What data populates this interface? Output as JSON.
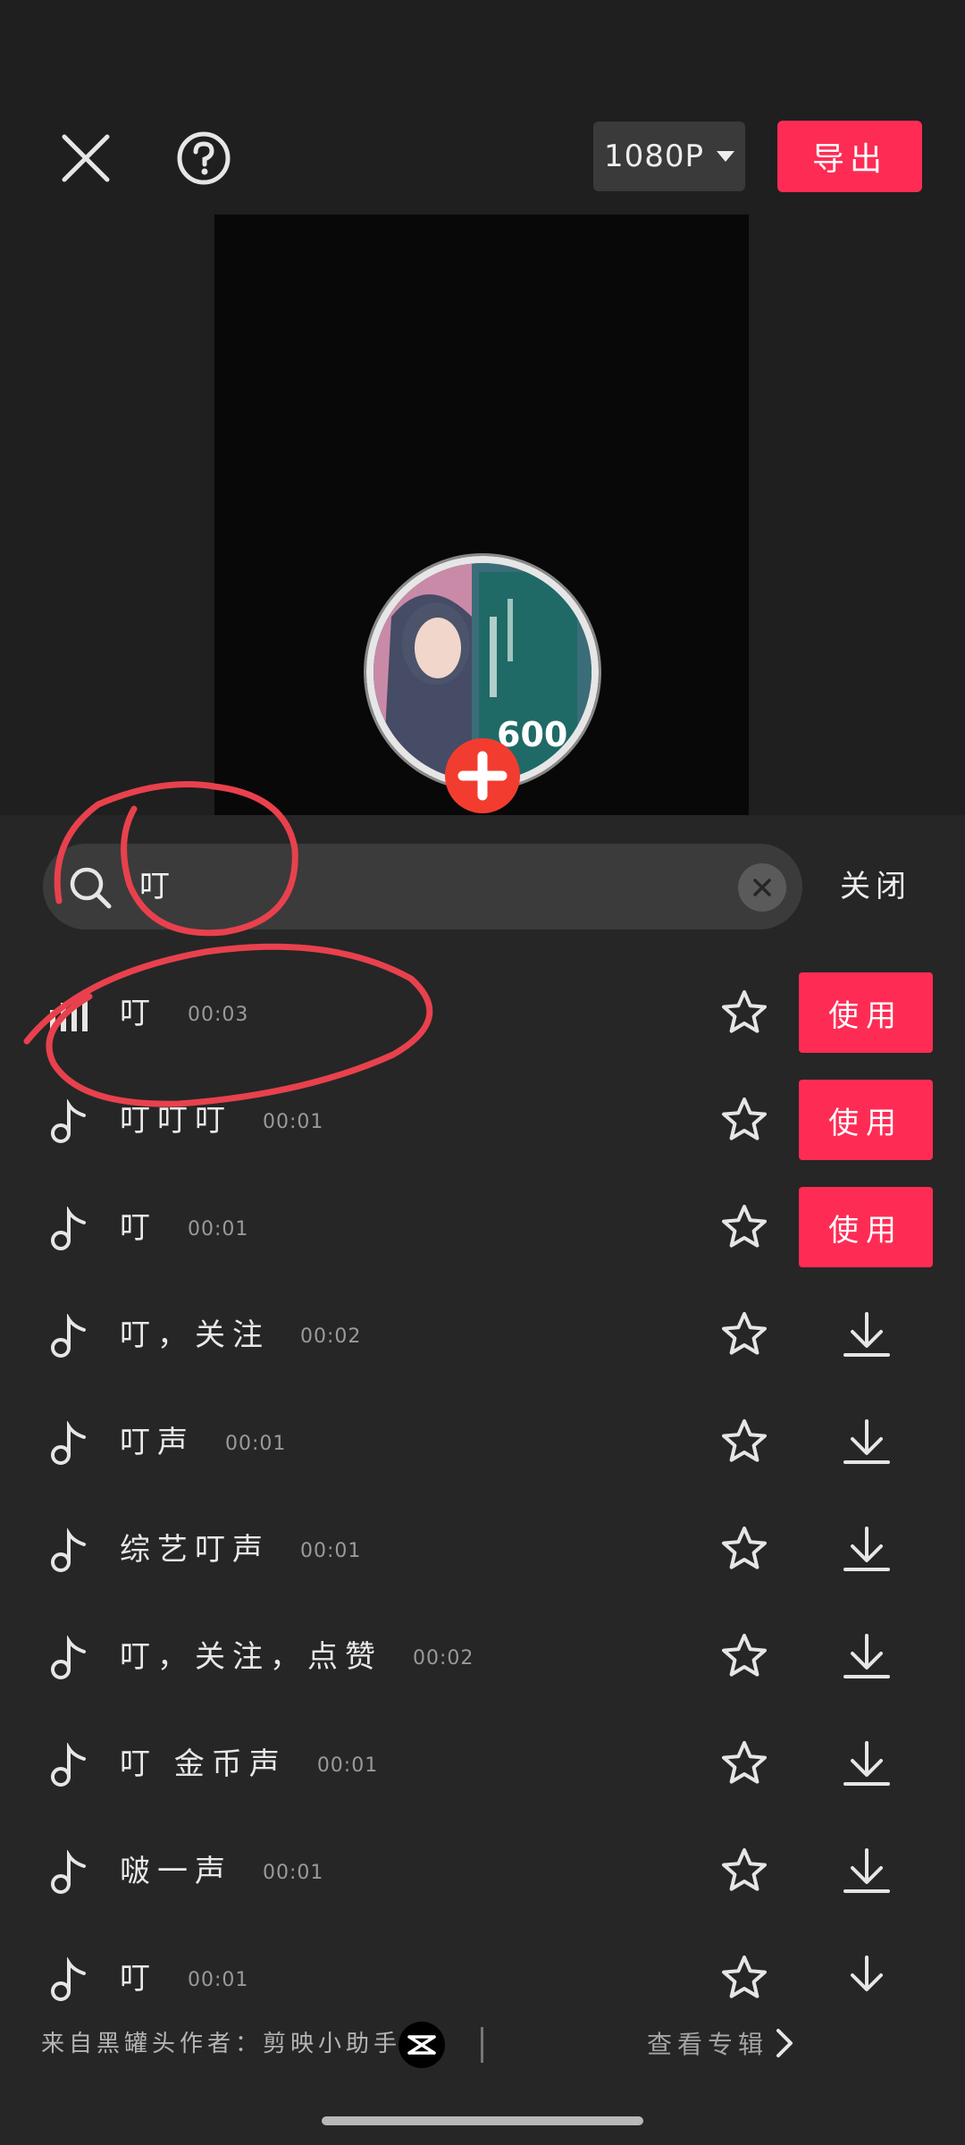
{
  "toolbar": {
    "resolution": "1080P",
    "export_label": "导出"
  },
  "search": {
    "query": "叮",
    "close_label": "关闭"
  },
  "results": [
    {
      "name": "叮",
      "duration": "00:03",
      "playing": true,
      "action": "使用"
    },
    {
      "name": "叮叮叮",
      "duration": "00:01",
      "playing": false,
      "action": "使用"
    },
    {
      "name": "叮",
      "duration": "00:01",
      "playing": false,
      "action": "使用"
    },
    {
      "name": "叮，关注",
      "duration": "00:02",
      "playing": false,
      "action": "download"
    },
    {
      "name": "叮声",
      "duration": "00:01",
      "playing": false,
      "action": "download"
    },
    {
      "name": "综艺叮声",
      "duration": "00:01",
      "playing": false,
      "action": "download"
    },
    {
      "name": "叮，关注，点赞",
      "duration": "00:02",
      "playing": false,
      "action": "download"
    },
    {
      "name": "叮 金币声",
      "duration": "00:01",
      "playing": false,
      "action": "download"
    },
    {
      "name": "啵一声",
      "duration": "00:01",
      "playing": false,
      "action": "download"
    },
    {
      "name": "叮",
      "duration": "00:01",
      "playing": false,
      "action": "download"
    }
  ],
  "footer": {
    "author": "来自黑罐头作者：剪映小助手",
    "album_link": "查看专辑"
  },
  "colors": {
    "accent": "#fe2c55",
    "panel": "#262626",
    "annotation": "#e8414d"
  },
  "icons": {
    "close": "close-icon",
    "help": "help-icon",
    "search": "search-icon",
    "favorite": "star-icon",
    "download": "download-icon",
    "music": "music-note-icon"
  }
}
